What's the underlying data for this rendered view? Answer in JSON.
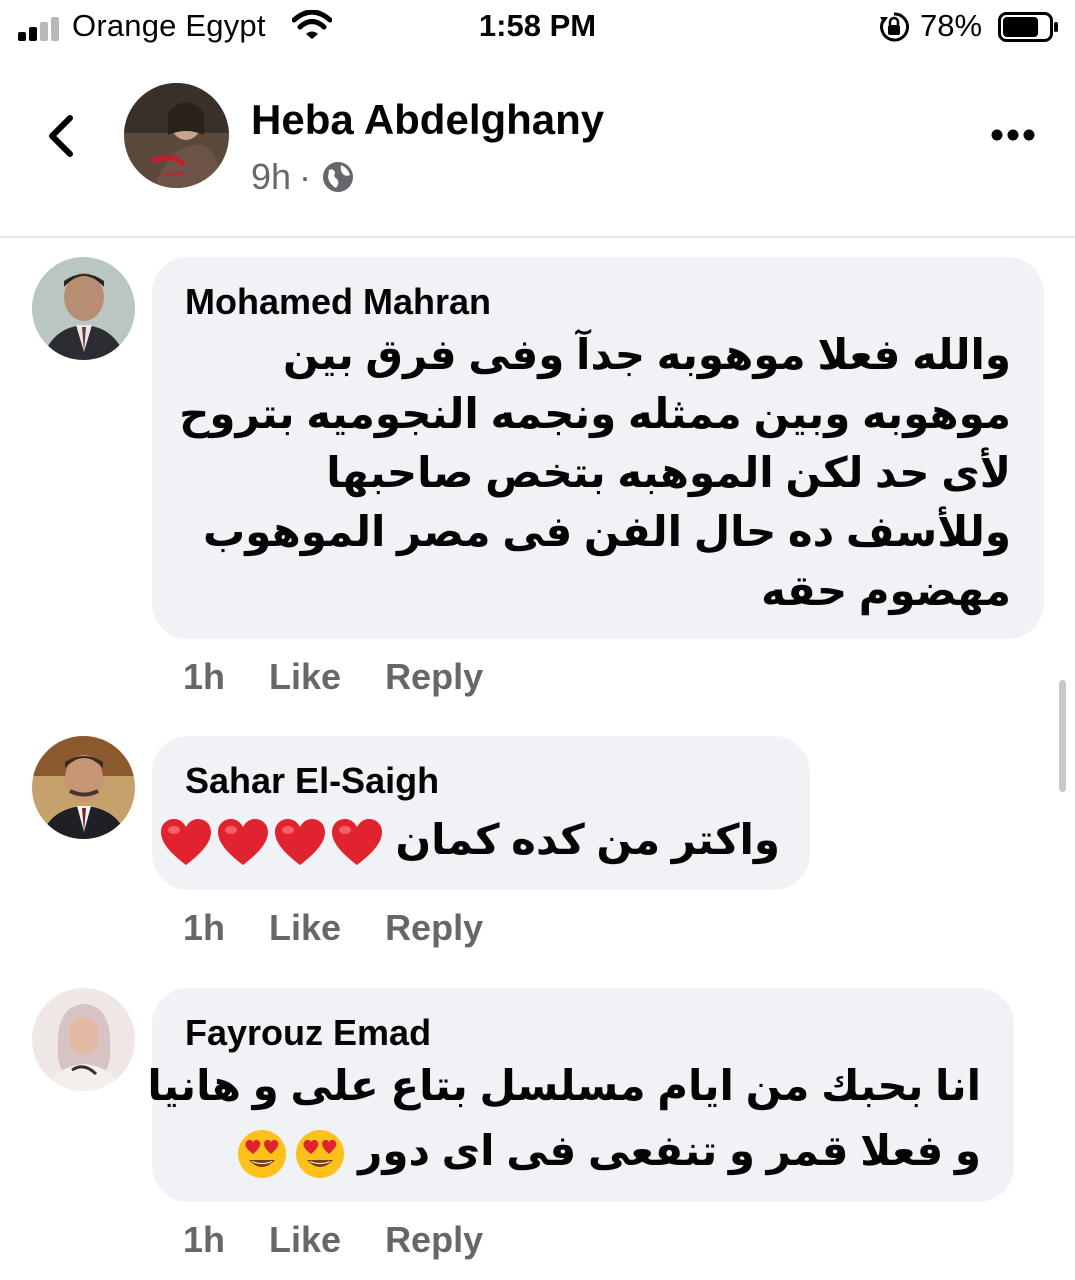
{
  "status_bar": {
    "carrier": "Orange Egypt",
    "time": "1:58 PM",
    "battery_percent": "78%",
    "battery_level": 0.78
  },
  "post_header": {
    "author": "Heba Abdelghany",
    "age": "9h",
    "separator": "·",
    "audience_icon": "globe-icon",
    "more_icon": "more-dots-icon"
  },
  "comments": [
    {
      "author": "Mohamed Mahran",
      "lines": [
        "والله فعلا موهوبه جدآ وفى فرق بين",
        "موهوبه وبين ممثله ونجمه النجوميه بتروح",
        "لأى حد لكن الموهبه بتخص صاحبها",
        "وللأسف ده حال الفن فى مصر الموهوب",
        "مهضوم حقه"
      ],
      "time": "1h",
      "like": "Like",
      "reply": "Reply"
    },
    {
      "author": "Sahar El-Saigh",
      "lines": [
        "واكتر من كده كمان"
      ],
      "trailing_emoji": "red-heart-icon",
      "emoji_count": 4,
      "time": "1h",
      "like": "Like",
      "reply": "Reply"
    },
    {
      "author": "Fayrouz Emad",
      "lines": [
        "انا بحبك من ايام مسلسل بتاع على و هانيا",
        "و فعلا قمر و تنفعى فى اى دور"
      ],
      "trailing_emoji": "heart-eyes-face-icon",
      "emoji_count": 2,
      "time": "1h",
      "like": "Like",
      "reply": "Reply"
    }
  ]
}
